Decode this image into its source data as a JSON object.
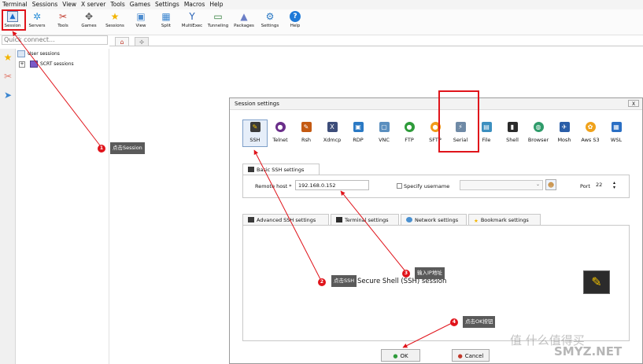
{
  "menu": [
    "Terminal",
    "Sessions",
    "View",
    "X server",
    "Tools",
    "Games",
    "Settings",
    "Macros",
    "Help"
  ],
  "toolbar": [
    {
      "label": "Session",
      "icon": "session-monitor-icon"
    },
    {
      "label": "Servers",
      "icon": "servers-icon"
    },
    {
      "label": "Tools",
      "icon": "tools-icon"
    },
    {
      "label": "Games",
      "icon": "games-icon"
    },
    {
      "label": "Sessions",
      "icon": "star-icon"
    },
    {
      "label": "View",
      "icon": "view-icon"
    },
    {
      "label": "Split",
      "icon": "split-icon"
    },
    {
      "label": "MultiExec",
      "icon": "multiexec-icon"
    },
    {
      "label": "Tunneling",
      "icon": "tunneling-icon"
    },
    {
      "label": "Packages",
      "icon": "packages-icon"
    },
    {
      "label": "Settings",
      "icon": "gear-icon"
    },
    {
      "label": "Help",
      "icon": "help-icon"
    }
  ],
  "quick_connect_placeholder": "Quick connect...",
  "tree": {
    "root": "User sessions",
    "child": "SCRT sessions"
  },
  "dialog": {
    "title": "Session settings",
    "close": "X",
    "protocols": [
      {
        "label": "SSH",
        "icon": "ssh-icon",
        "color": "#3a3a3a"
      },
      {
        "label": "Telnet",
        "icon": "telnet-icon",
        "color": "#6a2e8a"
      },
      {
        "label": "Rsh",
        "icon": "rsh-icon",
        "color": "#c45a12"
      },
      {
        "label": "Xdmcp",
        "icon": "xdmcp-icon",
        "color": "#3d4d7a"
      },
      {
        "label": "RDP",
        "icon": "rdp-icon",
        "color": "#2a79c4"
      },
      {
        "label": "VNC",
        "icon": "vnc-icon",
        "color": "#5b8fbf"
      },
      {
        "label": "FTP",
        "icon": "ftp-icon",
        "color": "#2e9b3a"
      },
      {
        "label": "SFTP",
        "icon": "sftp-icon",
        "color": "#f09a1a"
      },
      {
        "label": "Serial",
        "icon": "serial-icon",
        "color": "#6f8aa6"
      },
      {
        "label": "File",
        "icon": "file-icon",
        "color": "#3c8fbf"
      },
      {
        "label": "Shell",
        "icon": "shell-icon",
        "color": "#2b2b2b"
      },
      {
        "label": "Browser",
        "icon": "browser-icon",
        "color": "#2e9b6a"
      },
      {
        "label": "Mosh",
        "icon": "mosh-icon",
        "color": "#2a5ea8"
      },
      {
        "label": "Aws S3",
        "icon": "aws-s3-icon",
        "color": "#f0a21a"
      },
      {
        "label": "WSL",
        "icon": "wsl-icon",
        "color": "#2a6fc4"
      }
    ],
    "basic_tab": "Basic SSH settings",
    "remote_host_label": "Remote host *",
    "remote_host_value": "192.168.0.152",
    "specify_username_label": "Specify username",
    "port_label": "Port",
    "port_value": "22",
    "lower_tabs": [
      "Advanced SSH settings",
      "Terminal settings",
      "Network settings",
      "Bookmark settings"
    ],
    "description": "Secure Shell (SSH) session",
    "ok": "OK",
    "cancel": "Cancel"
  },
  "annotations": [
    {
      "n": "1",
      "text": "点击Session"
    },
    {
      "n": "2",
      "text": "点击SSH"
    },
    {
      "n": "3",
      "text": "输入IP地址"
    },
    {
      "n": "4",
      "text": "点击OK按钮"
    }
  ],
  "watermark": {
    "brand": "值 什么值得买",
    "domain": "SMYZ.NET"
  },
  "colors": {
    "annotation": "#e0141b",
    "callout": "#5a5a5a",
    "accent": "#1f6fd1"
  }
}
